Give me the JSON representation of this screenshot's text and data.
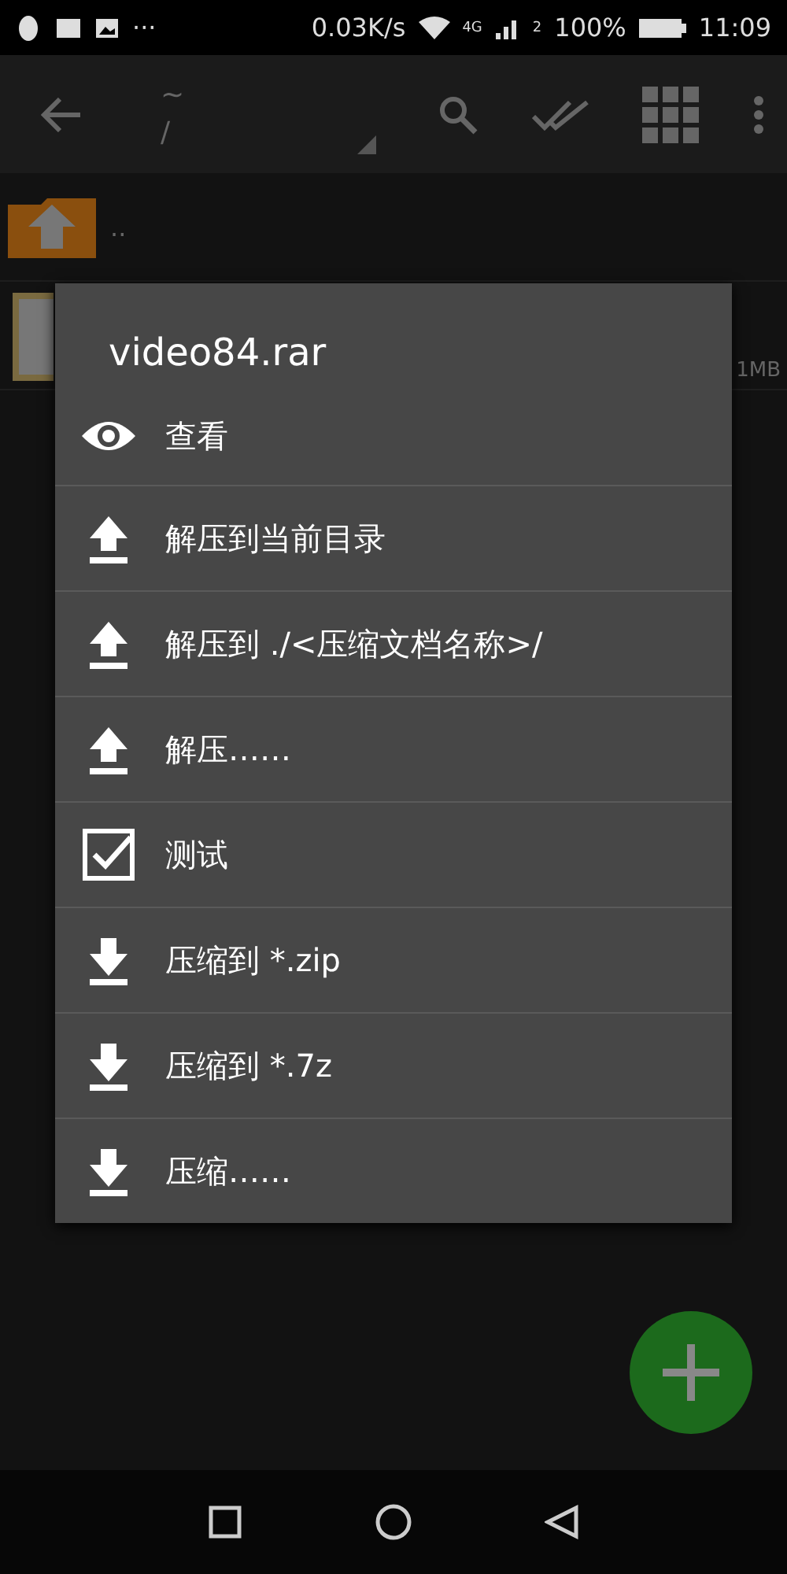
{
  "status_bar": {
    "more": "···",
    "speed": "0.03K/s",
    "network": "4G",
    "sim": "2",
    "battery": "100%",
    "time": "11:09"
  },
  "toolbar": {
    "path_top": "~",
    "path_bottom": "/"
  },
  "files": [
    {
      "kind": "parent",
      "name": ".."
    },
    {
      "kind": "archive",
      "size": "1MB"
    }
  ],
  "dialog": {
    "title": "video84.rar",
    "items": [
      {
        "kind": "view",
        "label": "查看"
      },
      {
        "kind": "extract",
        "label": "解压到当前目录"
      },
      {
        "kind": "extract",
        "label": "解压到 ./<压缩文档名称>/"
      },
      {
        "kind": "extract",
        "label": "解压……"
      },
      {
        "kind": "test",
        "label": "测试"
      },
      {
        "kind": "compress",
        "label": "压缩到 *.zip"
      },
      {
        "kind": "compress",
        "label": "压缩到 *.7z"
      },
      {
        "kind": "compress",
        "label": "压缩……"
      }
    ]
  }
}
